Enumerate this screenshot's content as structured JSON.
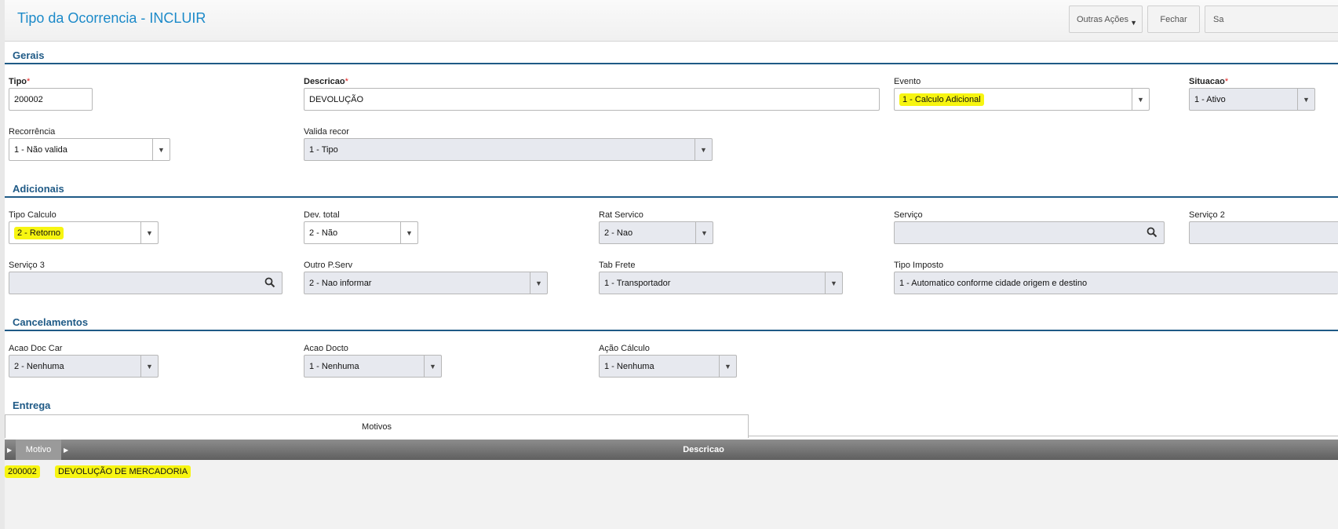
{
  "header": {
    "title": "Tipo da Ocorrencia - INCLUIR",
    "buttons": {
      "outras": "Outras Ações",
      "fechar": "Fechar",
      "salvar": "Sa"
    }
  },
  "sections": {
    "gerais": "Gerais",
    "adicionais": "Adicionais",
    "cancelamentos": "Cancelamentos",
    "entrega": "Entrega"
  },
  "gerais": {
    "tipo": {
      "label": "Tipo",
      "value": "200002"
    },
    "descricao": {
      "label": "Descricao",
      "value": "DEVOLUÇÃO"
    },
    "evento": {
      "label": "Evento",
      "value": "1 - Calculo Adicional"
    },
    "situacao": {
      "label": "Situacao",
      "value": "1 - Ativo"
    },
    "recorrencia": {
      "label": "Recorrência",
      "value": "1 - Não valida"
    },
    "valida_recor": {
      "label": "Valida recor",
      "value": "1 - Tipo"
    },
    "required_mark": "*"
  },
  "adicionais": {
    "tipo_calculo": {
      "label": "Tipo Calculo",
      "value": "2 - Retorno"
    },
    "dev_total": {
      "label": "Dev. total",
      "value": "2 - Não"
    },
    "rat_servico": {
      "label": "Rat Servico",
      "value": "2 - Nao"
    },
    "servico": {
      "label": "Serviço",
      "value": ""
    },
    "servico2": {
      "label": "Serviço 2",
      "value": ""
    },
    "servico3": {
      "label": "Serviço 3",
      "value": ""
    },
    "outro_pserv": {
      "label": "Outro P.Serv",
      "value": "2 - Nao informar"
    },
    "tab_frete": {
      "label": "Tab Frete",
      "value": "1 - Transportador"
    },
    "tipo_imposto": {
      "label": "Tipo Imposto",
      "value": "1 - Automatico conforme cidade origem e destino"
    }
  },
  "cancelamentos": {
    "acao_doc_car": {
      "label": "Acao Doc Car",
      "value": "2 - Nenhuma"
    },
    "acao_docto": {
      "label": "Acao Docto",
      "value": "1 - Nenhuma"
    },
    "acao_calculo": {
      "label": "Ação Cálculo",
      "value": "1 - Nenhuma"
    }
  },
  "entrega": {
    "tab": "Motivos",
    "columns": [
      "Motivo",
      "Descricao"
    ],
    "rows": [
      {
        "motivo": "200002",
        "descricao": "DEVOLUÇÃO DE MERCADORIA"
      }
    ]
  },
  "colors": {
    "title": "#1c8ac9",
    "section": "#1f5a86",
    "highlight": "#f7f511",
    "required": "#e01f1f"
  },
  "icons": [
    "dropdown-icon",
    "search-icon",
    "grid-arrow-icon"
  ]
}
